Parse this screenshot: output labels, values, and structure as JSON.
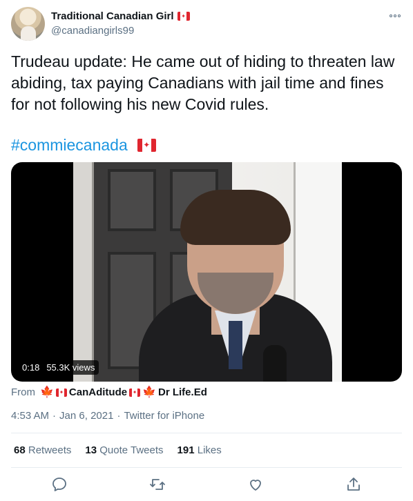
{
  "user": {
    "display_name": "Traditional Canadian Girl",
    "handle": "@canadiangirls99"
  },
  "tweet": {
    "text": "Trudeau update: He came out of hiding to threaten law abiding, tax paying Canadians with jail time and fines for not following his new Covid rules.",
    "hashtag": "#commiecanada"
  },
  "video": {
    "duration": "0:18",
    "views": "55.3K views"
  },
  "from": {
    "label": "From",
    "user_part1": "CanAditude",
    "user_part2": "Dr Life.Ed"
  },
  "meta": {
    "time": "4:53 AM",
    "separator1": "·",
    "date": "Jan 6, 2021",
    "separator2": "·",
    "source": "Twitter for iPhone"
  },
  "stats": {
    "retweets_count": "68",
    "retweets_label": "Retweets",
    "quote_count": "13",
    "quote_label": "Quote Tweets",
    "likes_count": "191",
    "likes_label": "Likes"
  },
  "icons": {
    "reply": "reply-icon",
    "retweet": "retweet-icon",
    "like": "like-icon",
    "share": "share-icon",
    "more": "more-icon",
    "flag": "canada-flag-icon"
  },
  "colors": {
    "link": "#1b95e0",
    "secondary_text": "#5b7083",
    "flag_red": "#e0262f"
  }
}
